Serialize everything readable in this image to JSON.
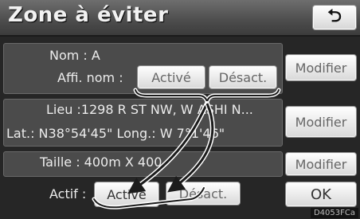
{
  "header": {
    "title": "Zone à éviter",
    "back_icon": "return-arrow-icon"
  },
  "name_row": {
    "name_text": "Nom : A",
    "display_label": "Affi. nom :",
    "on_label": "Activé",
    "off_label": "Désact.",
    "modify_label": "Modifier"
  },
  "location_row": {
    "address_text": "Lieu :1298 R ST NW, W ASHI N...",
    "coords_text": "Lat.: N38°54'45\"  Long.: W 7°1'46\"",
    "modify_label": "Modifier"
  },
  "size_row": {
    "size_text": "Taille : 400m X 400",
    "modify_label": "Modifier"
  },
  "active_row": {
    "label": "Actif :",
    "on_label": "Activé",
    "off_label": "Désact.",
    "ok_label": "OK"
  },
  "figure_code": "D4053FCa"
}
